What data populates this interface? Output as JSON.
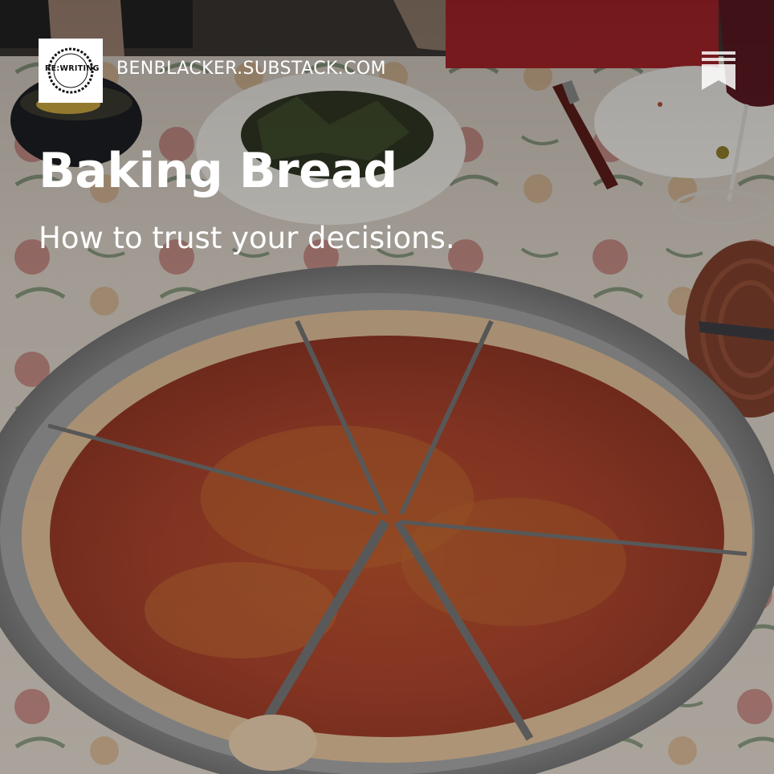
{
  "publication": {
    "logo_text": "RE:WRITING",
    "logo_ring_text": "BREAKING THE RULES",
    "domain": "BENBLACKER.SUBSTACK.COM"
  },
  "post": {
    "title": "Baking Bread",
    "subtitle": "How to trust your decisions."
  },
  "icons": {
    "bookmark": "bookmark-icon"
  },
  "colors": {
    "text": "#ffffff",
    "logo_bg": "#ffffff"
  }
}
